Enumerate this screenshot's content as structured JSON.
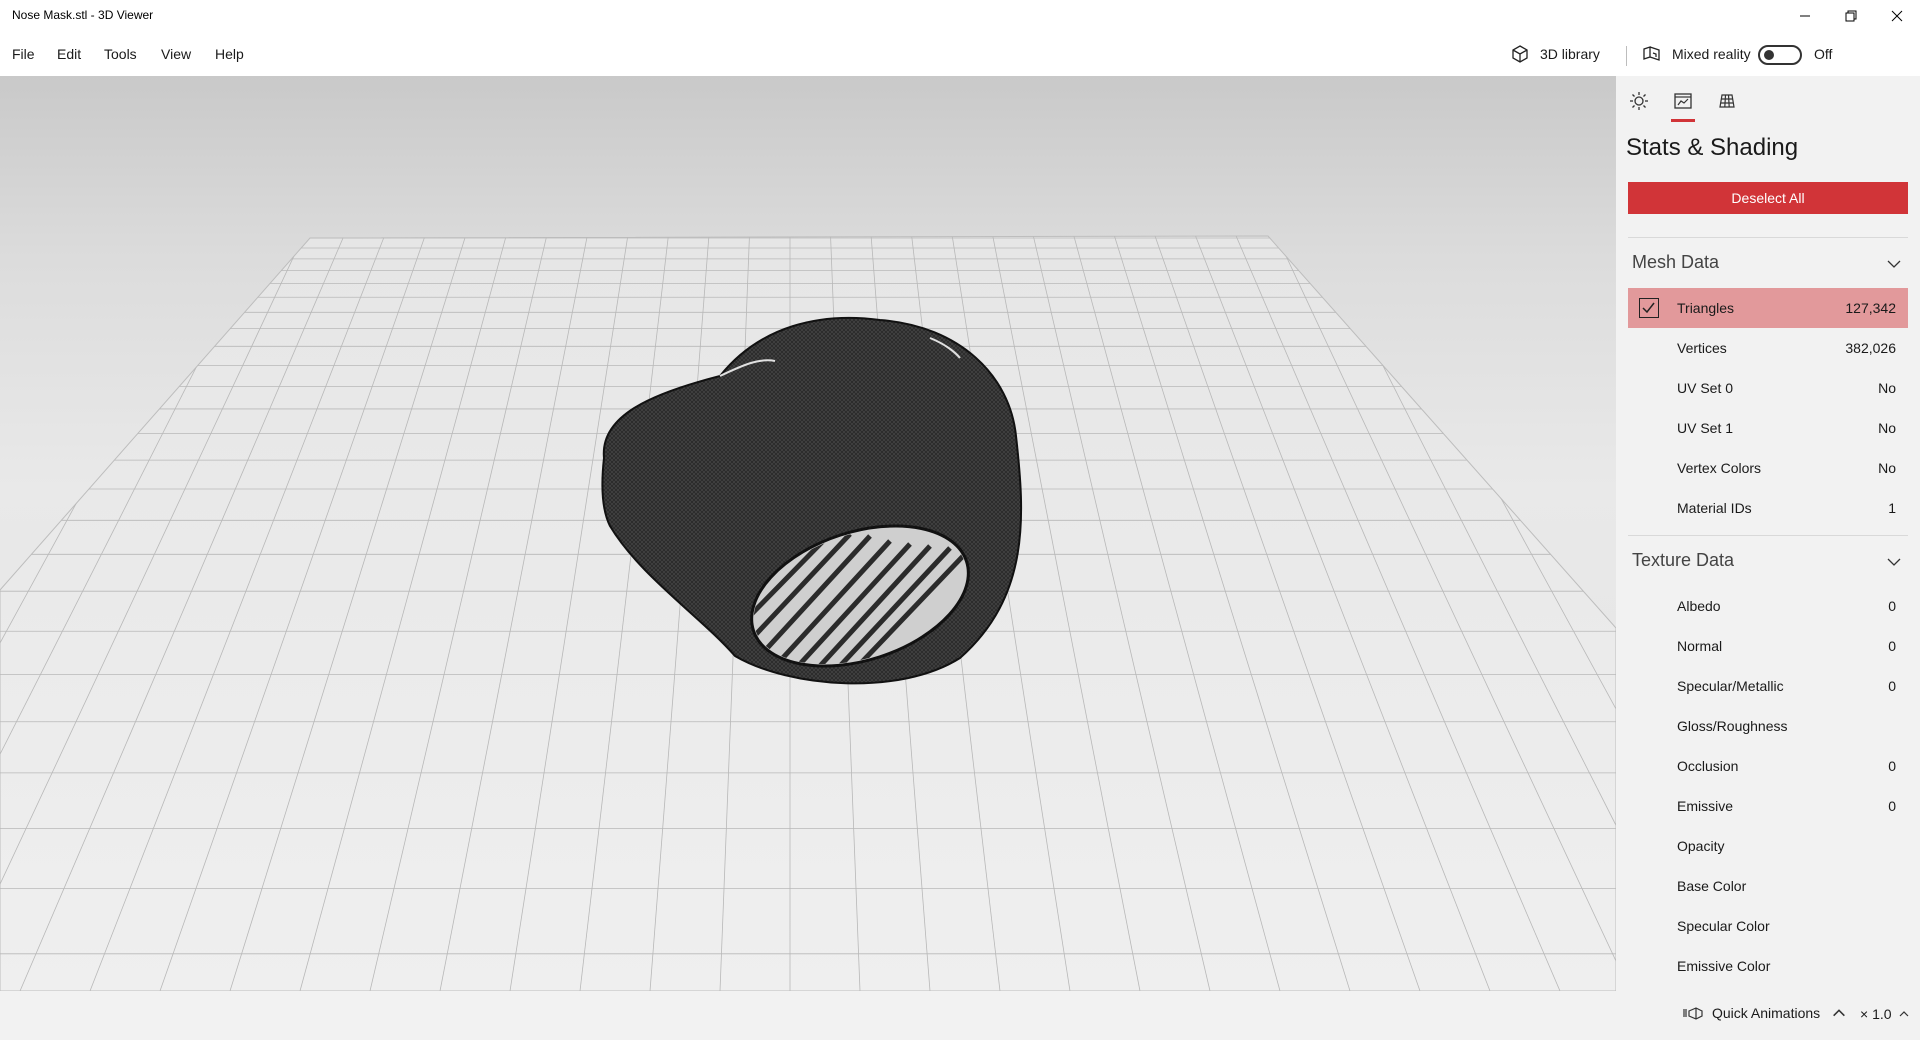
{
  "window": {
    "title": "Nose Mask.stl - 3D Viewer"
  },
  "menu": {
    "items": [
      "File",
      "Edit",
      "Tools",
      "View",
      "Help"
    ]
  },
  "toolbar": {
    "library_label": "3D library",
    "mixed_reality_label": "Mixed reality",
    "mixed_reality_state": "Off"
  },
  "panel": {
    "tabs": [
      "lighting-icon",
      "stats-icon",
      "grid-icon"
    ],
    "title": "Stats & Shading",
    "deselect_label": "Deselect All",
    "mesh_section": "Mesh Data",
    "mesh_rows": [
      {
        "label": "Triangles",
        "value": "127,342",
        "checked": true
      },
      {
        "label": "Vertices",
        "value": "382,026"
      },
      {
        "label": "UV Set 0",
        "value": "No"
      },
      {
        "label": "UV Set 1",
        "value": "No"
      },
      {
        "label": "Vertex Colors",
        "value": "No"
      },
      {
        "label": "Material IDs",
        "value": "1"
      }
    ],
    "texture_section": "Texture Data",
    "texture_rows": [
      {
        "label": "Albedo",
        "value": "0"
      },
      {
        "label": "Normal",
        "value": "0"
      },
      {
        "label": "Specular/Metallic",
        "value": "0"
      },
      {
        "label": "Gloss/Roughness",
        "value": ""
      },
      {
        "label": "Occlusion",
        "value": "0"
      },
      {
        "label": "Emissive",
        "value": "0"
      },
      {
        "label": "Opacity",
        "value": ""
      },
      {
        "label": "Base Color",
        "value": ""
      },
      {
        "label": "Specular Color",
        "value": ""
      },
      {
        "label": "Emissive Color",
        "value": ""
      }
    ]
  },
  "status": {
    "quick_animations": "Quick Animations",
    "speed": "× 1.0"
  },
  "colors": {
    "accent": "#d13438",
    "selected_row": "#e2999b",
    "panel_bg": "#f2f2f2"
  }
}
